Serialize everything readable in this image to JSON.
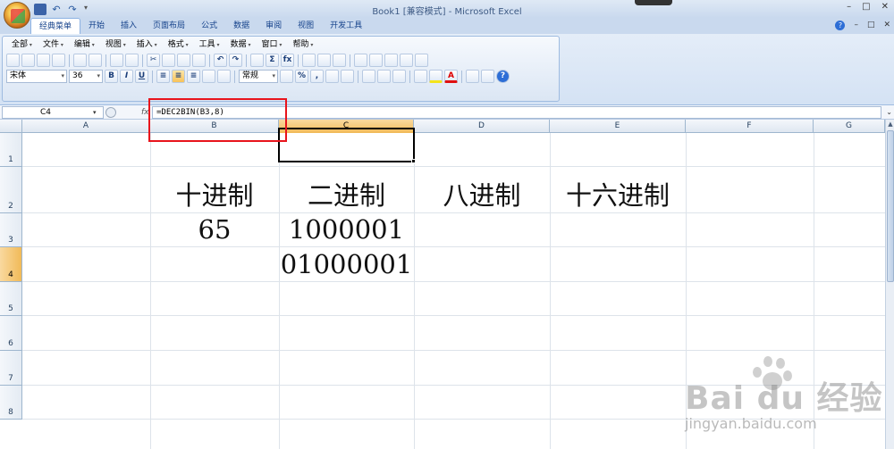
{
  "window": {
    "title": "Book1  [兼容模式] - Microsoft Excel",
    "controls": [
      "–",
      "□",
      "✕"
    ]
  },
  "tabs": [
    {
      "label": "经典菜单",
      "active": true
    },
    {
      "label": "开始"
    },
    {
      "label": "插入"
    },
    {
      "label": "页面布局"
    },
    {
      "label": "公式"
    },
    {
      "label": "数据"
    },
    {
      "label": "审阅"
    },
    {
      "label": "视图"
    },
    {
      "label": "开发工具"
    }
  ],
  "tab_right": {
    "help": "?",
    "minimize": "–",
    "restore": "□",
    "close": "✕"
  },
  "menus": [
    "全部",
    "文件",
    "编辑",
    "视图",
    "插入",
    "格式",
    "工具",
    "数据",
    "窗口",
    "帮助"
  ],
  "toolbar": {
    "font_name": "宋体",
    "font_size": "36",
    "bold": "B",
    "italic": "I",
    "underline": "U",
    "number_format": "常规",
    "percent": "%",
    "comma": ",",
    "sum": "Σ",
    "fx": "fx"
  },
  "formula_bar": {
    "name_box": "C4",
    "fx_label": "fx",
    "formula": "=DEC2BIN(B3,8)"
  },
  "columns": [
    "A",
    "B",
    "C",
    "D",
    "E",
    "F",
    "G"
  ],
  "selected_column": "C",
  "rows": [
    "1",
    "2",
    "3",
    "4",
    "5",
    "6",
    "7",
    "8"
  ],
  "selected_row": "4",
  "cells": {
    "B2": "十进制",
    "C2": "二进制",
    "D2": "八进制",
    "E2": "十六进制",
    "B3": "65",
    "C3": "1000001",
    "C4": "01000001"
  },
  "watermark": {
    "brand": "Bai du 经验",
    "url": "jingyan.baidu.com"
  }
}
